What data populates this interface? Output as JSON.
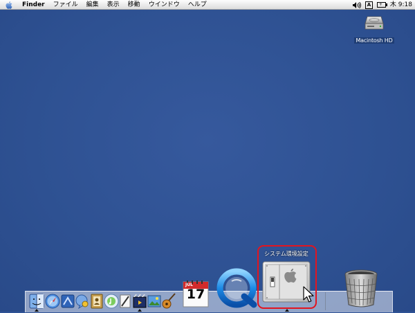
{
  "menubar": {
    "app_name": "Finder",
    "items": [
      "ファイル",
      "編集",
      "表示",
      "移動",
      "ウインドウ",
      "ヘルプ"
    ],
    "status": {
      "ime_indicator": "A",
      "clock": "木 9:18"
    }
  },
  "desktop": {
    "hard_disk_label": "Macintosh HD"
  },
  "dock": {
    "tooltip": "システム環境設定",
    "calendar_month": "JUL",
    "calendar_day": "17"
  },
  "icons": {
    "apple_menu": "apple-logo-icon",
    "volume": "speaker-icon",
    "battery": "battery-icon",
    "hard_disk": "hard-disk-icon",
    "trash": "trash-icon"
  },
  "colors": {
    "desktop": "#2f5395",
    "highlight": "#e3141e"
  }
}
